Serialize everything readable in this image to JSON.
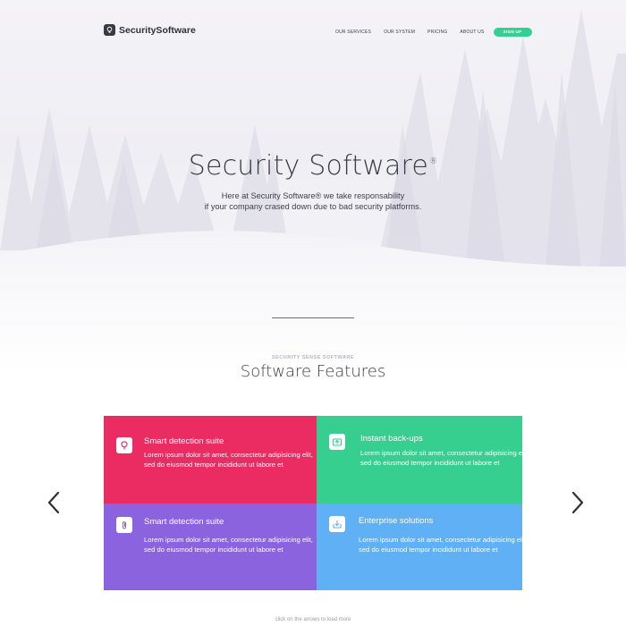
{
  "brand": {
    "name": "SecuritySoftware",
    "logo_icon": "bulb-icon"
  },
  "nav": {
    "items": [
      "OUR SERVICES",
      "OUR SYSTEM",
      "PRICING",
      "ABOUT US"
    ],
    "signup_label": "SIGN UP"
  },
  "hero": {
    "title": "Security Software",
    "title_mark": "®",
    "subtitle_line1": "Here at Security Software® we take responsability",
    "subtitle_line2": "if your company crased down due to bad security platforms."
  },
  "features": {
    "eyebrow": "SECURITY SENSE SOFTWARE",
    "title": "Software Features",
    "tiles": [
      {
        "title": "Smart detection suite",
        "icon": "bulb-icon",
        "color": "#ea2c62",
        "text": "Lorem ipsum dolor sit amet, consectetur adipisicing elit, sed do eiusmod tempor incididunt ut labore et"
      },
      {
        "title": "Instant back-ups",
        "icon": "upload-icon",
        "color": "#36cf90",
        "text": "Lorem ipsum dolor sit amet, consectetur adipisicing elit, sed do eiusmod tempor incididunt ut labore et"
      },
      {
        "title": "Smart detection suite",
        "icon": "paperclip-icon",
        "color": "#8b63df",
        "text": "Lorem ipsum dolor sit amet, consectetur adipisicing elit, sed do eiusmod tempor incididunt ut labore et"
      },
      {
        "title": "Enterprise solutions",
        "icon": "download-icon",
        "color": "#5fb0f4",
        "text": "Lorem ipsum dolor sit amet, consectetur adipisicing elit, sed do eiusmod tempor incididunt ut labore et"
      }
    ]
  },
  "carousel": {
    "prev_icon": "chevron-left-icon",
    "next_icon": "chevron-right-icon",
    "hint": "click on the arrows to load more"
  },
  "colors": {
    "accent": "#33d18f",
    "text_dark": "#3b3b45"
  }
}
